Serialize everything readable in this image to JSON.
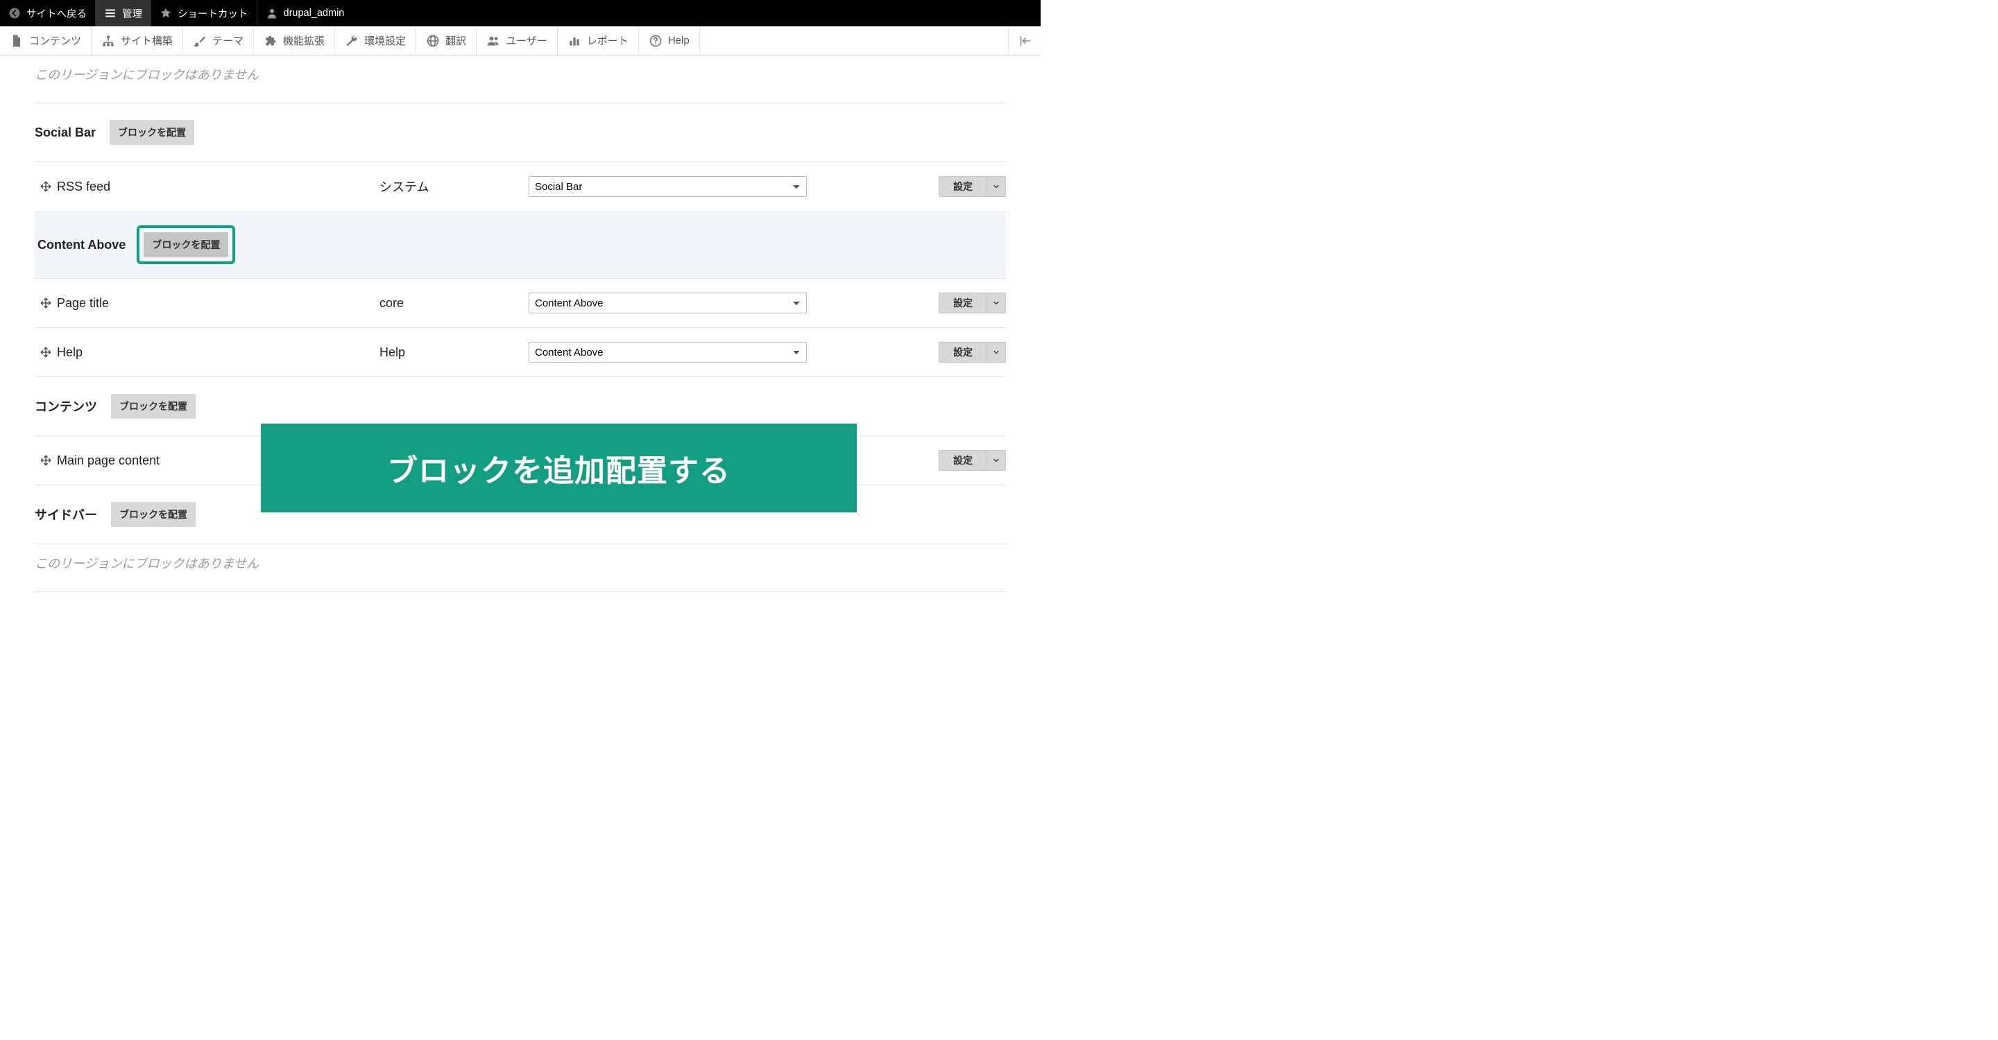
{
  "topbar": {
    "back_to_site": "サイトへ戻る",
    "manage": "管理",
    "shortcuts": "ショートカット",
    "user": "drupal_admin"
  },
  "admin_menu": {
    "content": "コンテンツ",
    "structure": "サイト構築",
    "appearance": "テーマ",
    "extend": "機能拡張",
    "configuration": "環境設定",
    "translate": "翻訳",
    "people": "ユーザー",
    "reports": "レポート",
    "help": "Help"
  },
  "labels": {
    "place_block": "ブロックを配置",
    "settings": "設定"
  },
  "empty_region_text": "このリージョンにブロックはありません",
  "regions": [
    {
      "key": "social_bar",
      "name": "Social Bar",
      "highlighted": false,
      "blocks": [
        {
          "name": "RSS feed",
          "category": "システム",
          "region_value": "Social Bar"
        }
      ],
      "show_empty_before": true
    },
    {
      "key": "content_above",
      "name": "Content Above",
      "highlighted": true,
      "blocks": [
        {
          "name": "Page title",
          "category": "core",
          "region_value": "Content Above"
        },
        {
          "name": "Help",
          "category": "Help",
          "region_value": "Content Above"
        }
      ]
    },
    {
      "key": "content",
      "name": "コンテンツ",
      "highlighted": false,
      "blocks": [
        {
          "name": "Main page content",
          "category": "",
          "region_value": ""
        }
      ]
    },
    {
      "key": "sidebar",
      "name": "サイドバー",
      "highlighted": false,
      "blocks": [],
      "show_empty_after": true
    }
  ],
  "overlay_banner": "ブロックを追加配置する"
}
